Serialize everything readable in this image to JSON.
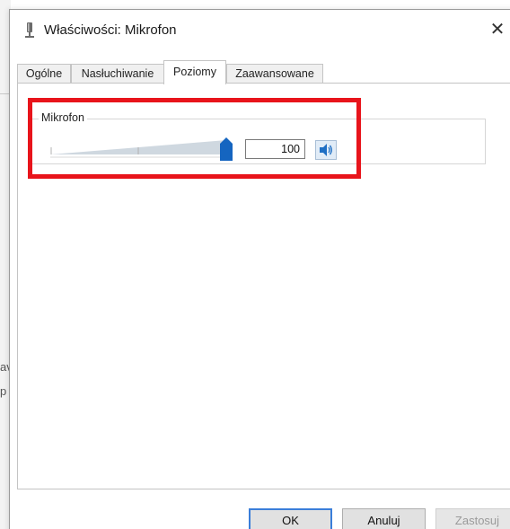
{
  "background": {
    "fragment_1": "av",
    "fragment_2": "p"
  },
  "window": {
    "title": "Właściwości: Mikrofon",
    "close_label": "✕"
  },
  "tabs": [
    {
      "label": "Ogólne",
      "active": false
    },
    {
      "label": "Nasłuchiwanie",
      "active": false
    },
    {
      "label": "Poziomy",
      "active": true
    },
    {
      "label": "Zaawansowane",
      "active": false
    }
  ],
  "levels": {
    "group_label": "Mikrofon",
    "slider_value_fraction": 1.0,
    "value": "100",
    "mute_icon": "speaker-icon"
  },
  "buttons": {
    "ok": "OK",
    "cancel": "Anuluj",
    "apply": "Zastosuj"
  },
  "colors": {
    "highlight": "#e8141b",
    "thumb": "#1565c0",
    "ok_border": "#3a7ed9"
  }
}
